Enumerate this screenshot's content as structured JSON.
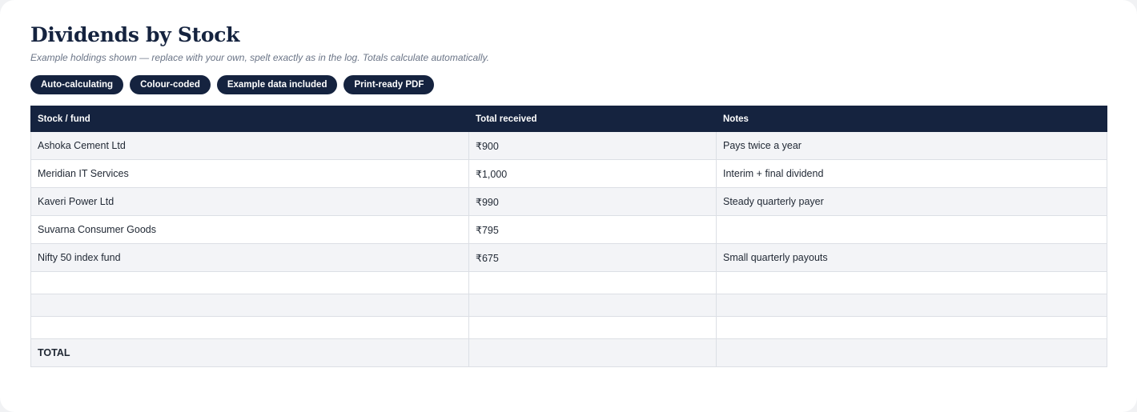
{
  "header": {
    "title": "Dividends by Stock",
    "subtitle": "Example holdings shown — replace with your own, spelt exactly as in the log. Totals calculate automatically."
  },
  "badges": [
    "Auto-calculating",
    "Colour-coded",
    "Example data included",
    "Print-ready PDF"
  ],
  "table": {
    "columns": [
      "Stock / fund",
      "Total received",
      "Notes"
    ],
    "rows": [
      {
        "stock": "Ashoka Cement Ltd",
        "total": "₹900",
        "notes": "Pays twice a year"
      },
      {
        "stock": "Meridian IT Services",
        "total": "₹1,000",
        "notes": "Interim + final dividend"
      },
      {
        "stock": "Kaveri Power Ltd",
        "total": "₹990",
        "notes": "Steady quarterly payer"
      },
      {
        "stock": "Suvarna Consumer Goods",
        "total": "₹795",
        "notes": ""
      },
      {
        "stock": "Nifty 50 index fund",
        "total": "₹675",
        "notes": "Small quarterly payouts"
      }
    ],
    "total_label": "TOTAL",
    "total_value": "",
    "total_notes": ""
  },
  "colors": {
    "navy": "#15233f",
    "stripe": "#f3f4f7",
    "border": "#dcdfe5"
  }
}
